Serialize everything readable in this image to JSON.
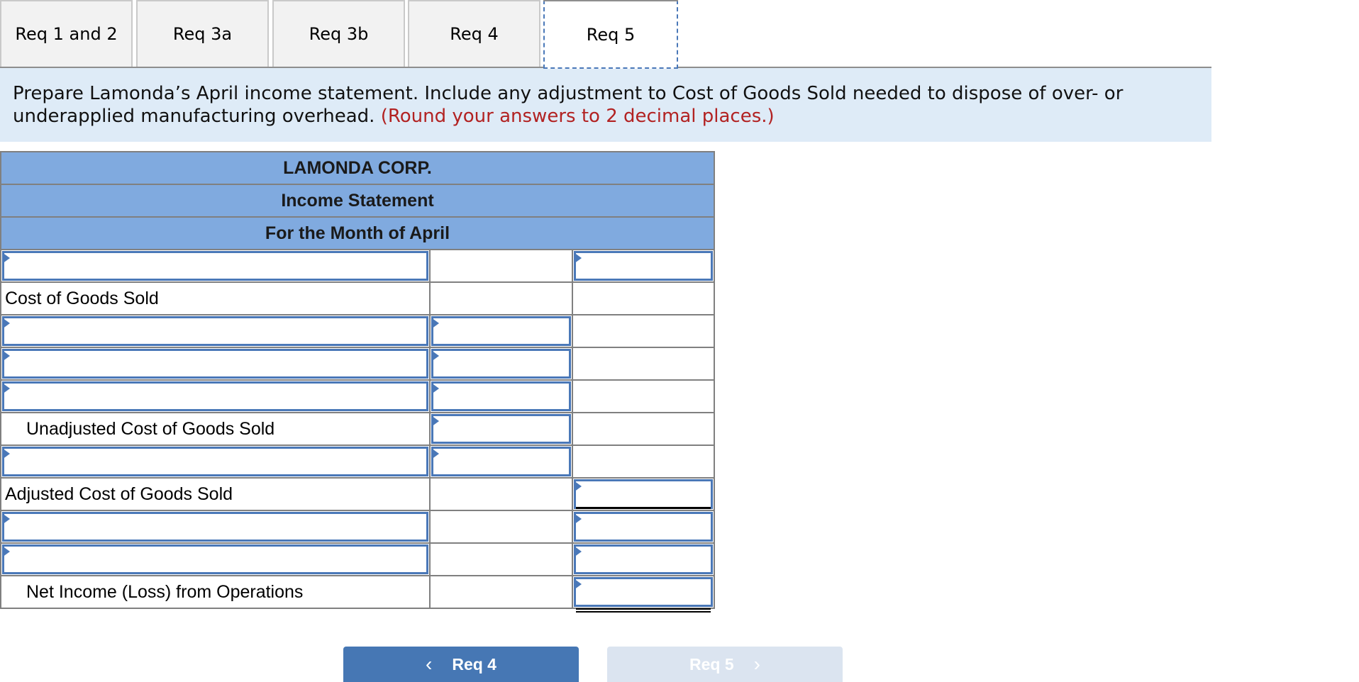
{
  "tabs": [
    {
      "label": "Req 1 and 2",
      "active": false
    },
    {
      "label": "Req 3a",
      "active": false
    },
    {
      "label": "Req 3b",
      "active": false
    },
    {
      "label": "Req 4",
      "active": false
    },
    {
      "label": "Req 5",
      "active": true
    }
  ],
  "instructions": {
    "text": "Prepare Lamonda’s April income statement. Include any adjustment to Cost of Goods Sold needed to dispose of over- or underapplied manufacturing overhead.",
    "note": "(Round your answers to 2 decimal places.)"
  },
  "statement": {
    "company": "LAMONDA CORP.",
    "title": "Income Statement",
    "period": "For the Month of April",
    "rows": [
      {
        "label": "",
        "col2": "",
        "col3": ""
      },
      {
        "label": "Cost of Goods Sold"
      },
      {
        "label": "",
        "col2": ""
      },
      {
        "label": "",
        "col2": ""
      },
      {
        "label": "",
        "col2": ""
      },
      {
        "label": "Unadjusted Cost of Goods Sold",
        "col2": ""
      },
      {
        "label": "",
        "col2": ""
      },
      {
        "label": "Adjusted Cost of Goods Sold",
        "col3": ""
      },
      {
        "label": "",
        "col3": ""
      },
      {
        "label": "",
        "col3": ""
      },
      {
        "label": "Net Income (Loss) from Operations",
        "col3": ""
      }
    ]
  },
  "nav": {
    "prev_label": "Req 4",
    "next_label": "Req 5",
    "prev_icon": "chevron-left-icon",
    "next_icon": "chevron-right-icon"
  },
  "colors": {
    "accent": "#4677b4",
    "header_fill": "#80aadf",
    "instruction_bg": "#deebf7",
    "note_red": "#b22222",
    "disabled_button": "#dbe4f0"
  }
}
